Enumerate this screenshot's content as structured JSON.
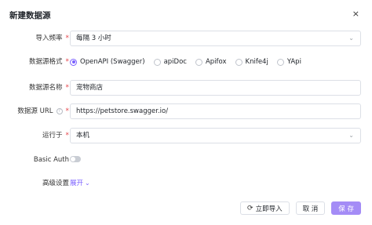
{
  "dialog": {
    "title": "新建数据源",
    "close": "×"
  },
  "form": {
    "import_frequency": {
      "label": "导入频率",
      "value": "每隔 3 小时"
    },
    "format": {
      "label": "数据源格式",
      "options": [
        "OpenAPI (Swagger)",
        "apiDoc",
        "Apifox",
        "Knife4j",
        "YApi"
      ],
      "selected": "OpenAPI (Swagger)"
    },
    "name": {
      "label": "数据源名称",
      "value": "宠物商店"
    },
    "url": {
      "label": "数据源 URL",
      "value": "https://petstore.swagger.io/"
    },
    "run_on": {
      "label": "运行于",
      "value": "本机"
    },
    "basic_auth": {
      "label": "Basic Auth",
      "enabled": false
    },
    "advanced": {
      "label": "高级设置",
      "toggle": "展开"
    }
  },
  "footer": {
    "import_now": "立即导入",
    "cancel": "取 消",
    "save": "保 存"
  },
  "colors": {
    "accent": "#7b61ff",
    "primary_button": "#a48cf6",
    "required": "#e5484d"
  }
}
